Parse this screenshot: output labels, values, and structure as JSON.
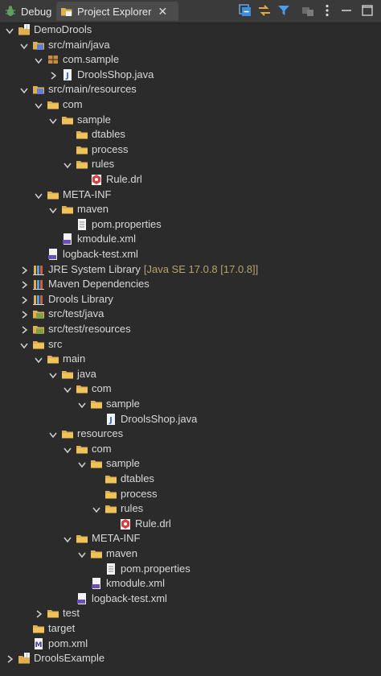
{
  "tabs": {
    "debug": "Debug",
    "project_explorer": "Project Explorer",
    "close": "✕"
  },
  "toolbar": {
    "icons": [
      "collapse-all-icon",
      "link-with-editor-icon",
      "filter-icon",
      "focus-icon",
      "view-menu-icon",
      "minimize-icon",
      "maximize-icon"
    ]
  },
  "tree": [
    {
      "label": "DemoDrools",
      "depth": 0,
      "state": "expanded",
      "icon": "project-icon"
    },
    {
      "label": "src/main/java",
      "depth": 1,
      "state": "expanded",
      "icon": "source-folder-icon"
    },
    {
      "label": "com.sample",
      "depth": 2,
      "state": "expanded",
      "icon": "package-icon"
    },
    {
      "label": "DroolsShop.java",
      "depth": 3,
      "state": "collapsed",
      "icon": "java-file-icon"
    },
    {
      "label": "src/main/resources",
      "depth": 1,
      "state": "expanded",
      "icon": "source-folder-icon"
    },
    {
      "label": "com",
      "depth": 2,
      "state": "expanded",
      "icon": "folder-icon"
    },
    {
      "label": "sample",
      "depth": 3,
      "state": "expanded",
      "icon": "folder-icon"
    },
    {
      "label": "dtables",
      "depth": 4,
      "state": "none",
      "icon": "folder-icon"
    },
    {
      "label": "process",
      "depth": 4,
      "state": "none",
      "icon": "folder-icon"
    },
    {
      "label": "rules",
      "depth": 4,
      "state": "expanded",
      "icon": "folder-icon"
    },
    {
      "label": "Rule.drl",
      "depth": 5,
      "state": "none",
      "icon": "drools-rule-file-icon"
    },
    {
      "label": "META-INF",
      "depth": 2,
      "state": "expanded",
      "icon": "folder-icon"
    },
    {
      "label": "maven",
      "depth": 3,
      "state": "expanded",
      "icon": "folder-icon"
    },
    {
      "label": "pom.properties",
      "depth": 4,
      "state": "none",
      "icon": "properties-file-icon"
    },
    {
      "label": "kmodule.xml",
      "depth": 3,
      "state": "none",
      "icon": "xml-file-icon"
    },
    {
      "label": "logback-test.xml",
      "depth": 2,
      "state": "none",
      "icon": "xml-file-icon"
    },
    {
      "label": "JRE System Library",
      "decoration": "[Java SE 17.0.8 [17.0.8]]",
      "depth": 1,
      "state": "collapsed",
      "icon": "library-icon"
    },
    {
      "label": "Maven Dependencies",
      "depth": 1,
      "state": "collapsed",
      "icon": "library-icon"
    },
    {
      "label": "Drools Library",
      "depth": 1,
      "state": "collapsed",
      "icon": "library-icon"
    },
    {
      "label": "src/test/java",
      "depth": 1,
      "state": "collapsed",
      "icon": "test-source-folder-icon"
    },
    {
      "label": "src/test/resources",
      "depth": 1,
      "state": "collapsed",
      "icon": "test-source-folder-icon"
    },
    {
      "label": "src",
      "depth": 1,
      "state": "expanded",
      "icon": "folder-icon"
    },
    {
      "label": "main",
      "depth": 2,
      "state": "expanded",
      "icon": "folder-icon"
    },
    {
      "label": "java",
      "depth": 3,
      "state": "expanded",
      "icon": "folder-icon"
    },
    {
      "label": "com",
      "depth": 4,
      "state": "expanded",
      "icon": "folder-icon"
    },
    {
      "label": "sample",
      "depth": 5,
      "state": "expanded",
      "icon": "folder-icon"
    },
    {
      "label": "DroolsShop.java",
      "depth": 6,
      "state": "none",
      "icon": "java-file-icon"
    },
    {
      "label": "resources",
      "depth": 3,
      "state": "expanded",
      "icon": "folder-icon"
    },
    {
      "label": "com",
      "depth": 4,
      "state": "expanded",
      "icon": "folder-icon"
    },
    {
      "label": "sample",
      "depth": 5,
      "state": "expanded",
      "icon": "folder-icon"
    },
    {
      "label": "dtables",
      "depth": 6,
      "state": "none",
      "icon": "folder-icon"
    },
    {
      "label": "process",
      "depth": 6,
      "state": "none",
      "icon": "folder-icon"
    },
    {
      "label": "rules",
      "depth": 6,
      "state": "expanded",
      "icon": "folder-icon"
    },
    {
      "label": "Rule.drl",
      "depth": 7,
      "state": "none",
      "icon": "drools-rule-file-icon"
    },
    {
      "label": "META-INF",
      "depth": 4,
      "state": "expanded",
      "icon": "folder-icon"
    },
    {
      "label": "maven",
      "depth": 5,
      "state": "expanded",
      "icon": "folder-icon"
    },
    {
      "label": "pom.properties",
      "depth": 6,
      "state": "none",
      "icon": "properties-file-icon"
    },
    {
      "label": "kmodule.xml",
      "depth": 5,
      "state": "none",
      "icon": "xml-file-icon"
    },
    {
      "label": "logback-test.xml",
      "depth": 4,
      "state": "none",
      "icon": "xml-file-icon"
    },
    {
      "label": "test",
      "depth": 2,
      "state": "collapsed",
      "icon": "folder-icon"
    },
    {
      "label": "target",
      "depth": 1,
      "state": "none",
      "icon": "folder-icon"
    },
    {
      "label": "pom.xml",
      "depth": 1,
      "state": "none",
      "icon": "maven-pom-icon"
    },
    {
      "label": "DroolsExample",
      "depth": 0,
      "state": "collapsed",
      "icon": "project-icon"
    }
  ],
  "colors": {
    "background": "#2b2b2b",
    "tabbar": "#3a3a3a",
    "active_tab": "#4b4b4b",
    "text": "#d8d8d8",
    "decoration": "#b5a36a",
    "folder": "#e0b050",
    "twisty": "#cfcfcf",
    "accent": "#3d8ee0"
  }
}
